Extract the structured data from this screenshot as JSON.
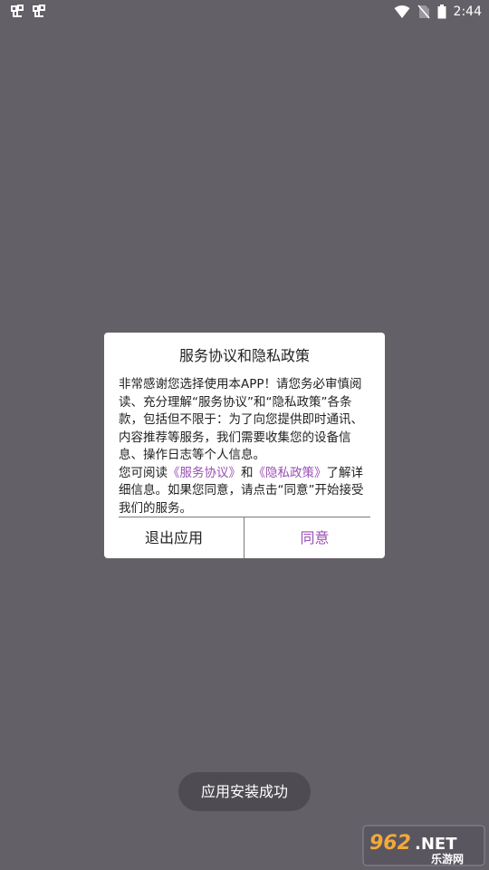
{
  "status_bar": {
    "time": "2:44",
    "left_icons": [
      "app-notification-icon",
      "app-notification-icon"
    ],
    "right_icons": [
      "wifi-icon",
      "no-sim-icon",
      "battery-icon"
    ]
  },
  "dialog": {
    "title": "服务协议和隐私政策",
    "paragraph1": "非常感谢您选择使用本APP！请您务必审慎阅读、充分理解“服务协议”和“隐私政策”各条款，包括但不限于：为了向您提供即时通讯、内容推荐等服务，我们需要收集您的设备信息、操作日志等个人信息。",
    "p2_prefix": "您可阅读",
    "service_link": "《服务协议》",
    "p2_and": "和",
    "privacy_link": "《隐私政策》",
    "p2_suffix": "了解详细信息。如果您同意，请点击“同意”开始接受我们的服务。",
    "exit_button": "退出应用",
    "agree_button": "同意"
  },
  "toast": {
    "text": "应用安装成功"
  },
  "watermark": {
    "text": "962.NET",
    "subtext": "乐游网"
  },
  "colors": {
    "overlay": "#646067",
    "accent": "#9a4fb3",
    "toast_bg": "#4f4b52"
  }
}
